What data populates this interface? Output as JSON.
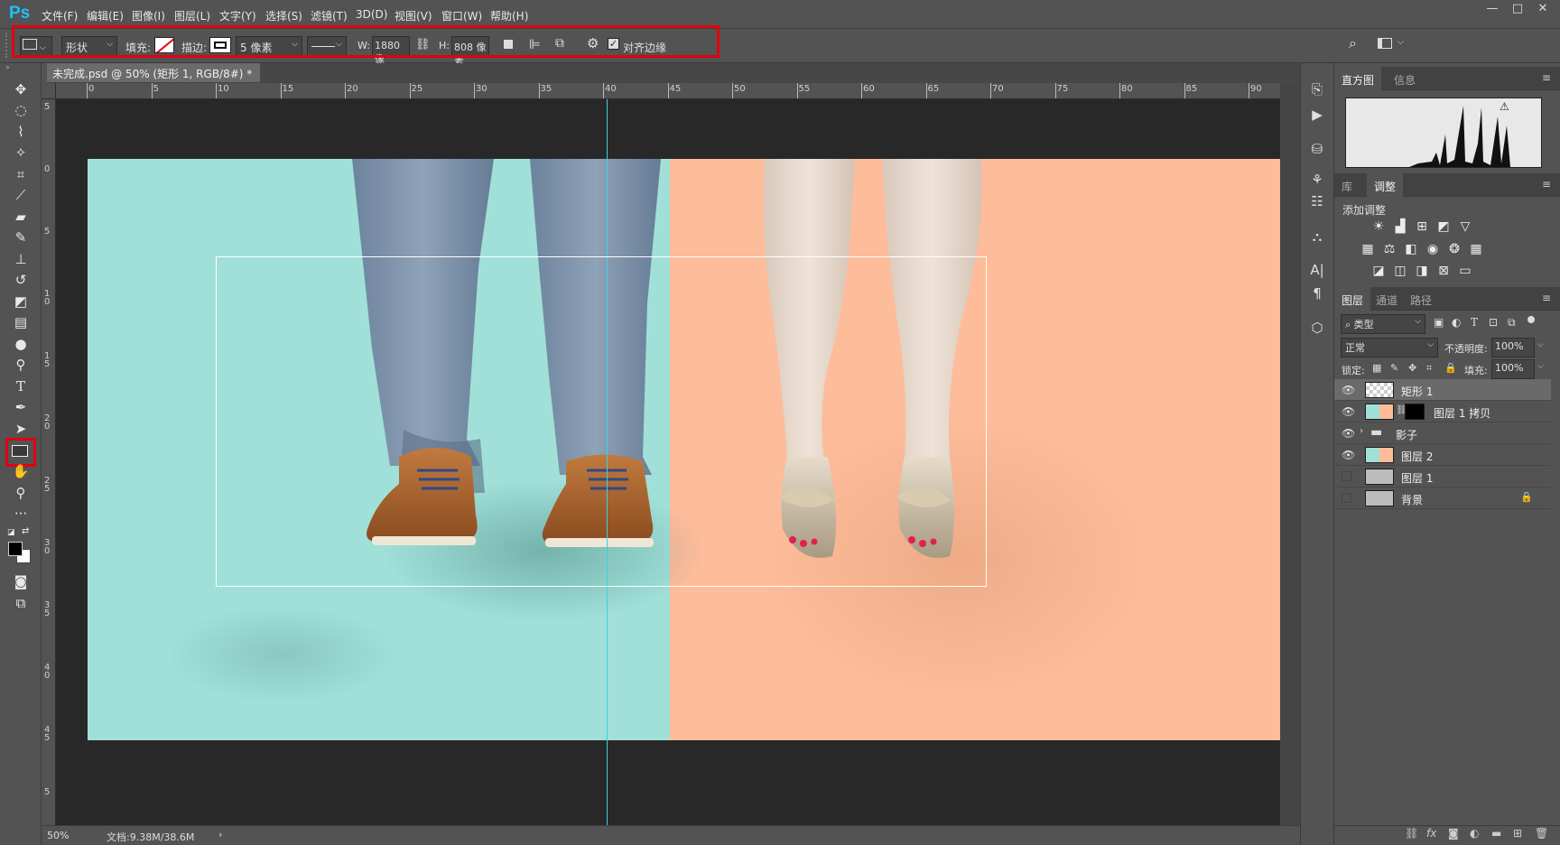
{
  "app": {
    "logo": "Ps",
    "menu": [
      "文件(F)",
      "编辑(E)",
      "图像(I)",
      "图层(L)",
      "文字(Y)",
      "选择(S)",
      "滤镜(T)",
      "3D(D)",
      "视图(V)",
      "窗口(W)",
      "帮助(H)"
    ],
    "window_buttons": [
      "—",
      "□",
      "✕"
    ]
  },
  "options": {
    "mode": "形状",
    "fill_label": "填充:",
    "stroke_label": "描边:",
    "stroke_width": "5 像素",
    "w_label": "W:",
    "w_value": "1880 像",
    "h_label": "H:",
    "h_value": "808 像素",
    "align_edges_label": "对齐边缘",
    "align_edges_checked": true
  },
  "document": {
    "tab_title": "未完成.psd @ 50% (矩形 1, RGB/8#) *",
    "close": "×",
    "zoom": "50%",
    "doc_info": "文档:9.38M/38.6M",
    "left_bg": "#a0e0d8",
    "right_bg": "#fdbc9a"
  },
  "ruler": {
    "h_ticks": [
      "0",
      "5",
      "10",
      "15",
      "20",
      "25",
      "30",
      "35",
      "40",
      "45",
      "50",
      "55",
      "60",
      "65",
      "70",
      "75",
      "80",
      "85",
      "90"
    ],
    "v_ticks": [
      "5",
      "0",
      "5",
      "1 0",
      "1 5",
      "2 0",
      "2 5",
      "3 0",
      "3 5",
      "4 0",
      "4 5",
      "5"
    ]
  },
  "tools": [
    "move-icon",
    "lasso-ellipse-icon",
    "quick-select-icon",
    "magic-wand-icon",
    "crop-icon",
    "eyedropper-icon",
    "healing-icon",
    "brush-icon",
    "stamp-icon",
    "history-brush-icon",
    "eraser-icon",
    "gradient-icon",
    "blur-icon",
    "dodge-icon",
    "type-icon",
    "pen-icon",
    "path-select-icon",
    "rectangle-icon",
    "hand-icon",
    "zoom-icon",
    "more-icon"
  ],
  "panels": {
    "histogram_tabs": [
      "直方图",
      "信息"
    ],
    "adjust_tabs": [
      "库",
      "调整"
    ],
    "add_adjustment": "添加调整",
    "layers_tabs": [
      "图层",
      "通道",
      "路径"
    ],
    "filter_kind": "类型",
    "blend_mode": "正常",
    "opacity_label": "不透明度:",
    "opacity_value": "100%",
    "lock_label": "锁定:",
    "fill_label": "填充:",
    "fill_value": "100%"
  },
  "layers": [
    {
      "name": "矩形 1",
      "visible": true,
      "selected": true
    },
    {
      "name": "图层 1 拷贝",
      "visible": true,
      "selected": false
    },
    {
      "name": "影子",
      "visible": true,
      "selected": false,
      "group": true
    },
    {
      "name": "图层 2",
      "visible": true,
      "selected": false
    },
    {
      "name": "图层 1",
      "visible": false,
      "selected": false
    },
    {
      "name": "背景",
      "visible": false,
      "selected": false,
      "locked": true
    }
  ]
}
